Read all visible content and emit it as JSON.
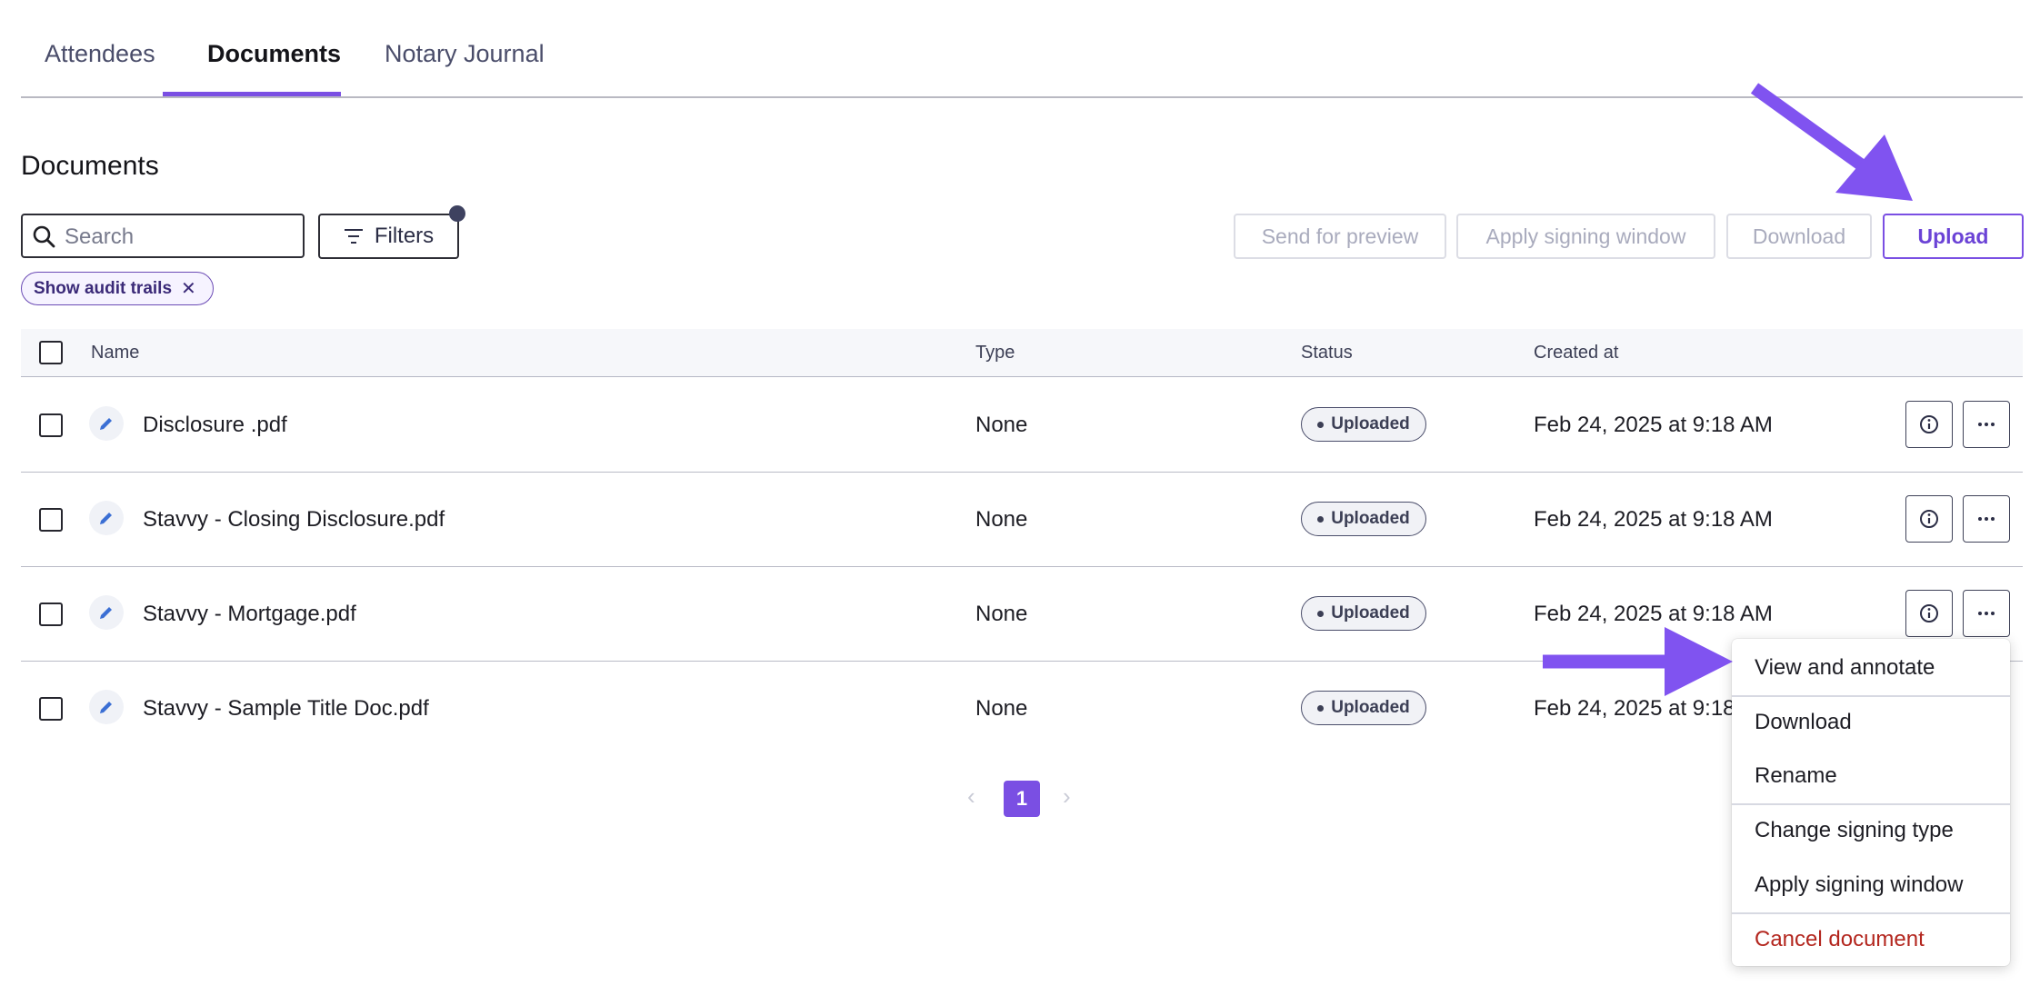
{
  "tabs": [
    {
      "label": "Attendees"
    },
    {
      "label": "Documents"
    },
    {
      "label": "Notary Journal"
    }
  ],
  "section_title": "Documents",
  "search": {
    "placeholder": "Search",
    "value": ""
  },
  "toolbar": {
    "filters_label": "Filters",
    "send_preview_label": "Send for preview",
    "apply_window_label": "Apply signing window",
    "download_label": "Download",
    "upload_label": "Upload"
  },
  "chip": {
    "label": "Show audit trails"
  },
  "table": {
    "headers": {
      "name": "Name",
      "type": "Type",
      "status": "Status",
      "created": "Created at"
    },
    "rows": [
      {
        "name": "Disclosure .pdf",
        "type": "None",
        "status": "Uploaded",
        "created": "Feb 24, 2025 at 9:18 AM"
      },
      {
        "name": "Stavvy - Closing Disclosure.pdf",
        "type": "None",
        "status": "Uploaded",
        "created": "Feb 24, 2025 at 9:18 AM"
      },
      {
        "name": "Stavvy - Mortgage.pdf",
        "type": "None",
        "status": "Uploaded",
        "created": "Feb 24, 2025 at 9:18 AM"
      },
      {
        "name": "Stavvy - Sample Title Doc.pdf",
        "type": "None",
        "status": "Uploaded",
        "created": "Feb 24, 2025 at 9:18 AM"
      }
    ]
  },
  "pagination": {
    "current": "1",
    "prev_icon": "chevron-left-icon",
    "next_icon": "chevron-right-icon"
  },
  "menu": {
    "items": [
      {
        "label": "View and annotate"
      },
      {
        "label": "Download"
      },
      {
        "label": "Rename"
      },
      {
        "label": "Change signing type"
      },
      {
        "label": "Apply signing window"
      },
      {
        "label": "Cancel document"
      }
    ]
  },
  "colors": {
    "accent": "#7a4fe3",
    "danger": "#b3261e",
    "arrow": "#8053f0"
  }
}
